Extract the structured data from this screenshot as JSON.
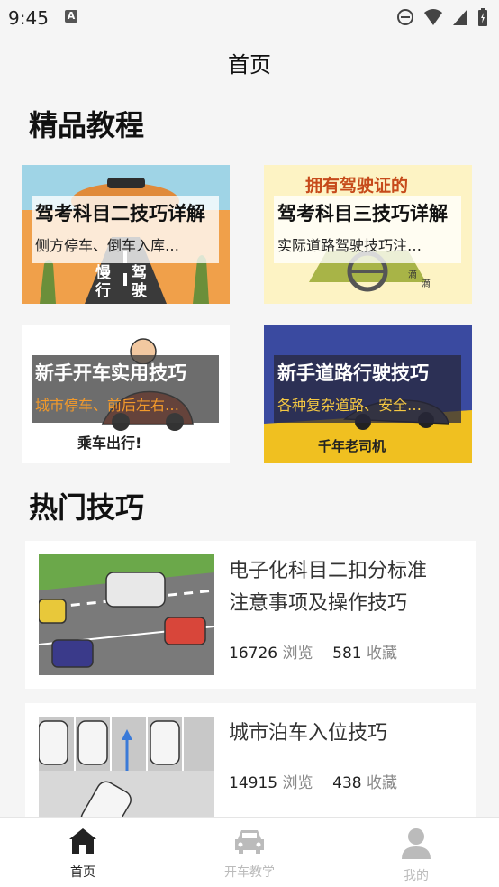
{
  "status_bar": {
    "time": "9:45"
  },
  "header": {
    "title": "首页"
  },
  "section_featured": {
    "title": "精品教程"
  },
  "featured": [
    {
      "title": "驾考科目二技巧详解",
      "subtitle": "侧方停车、倒车入库…",
      "banner": "慢 驾 行 驶"
    },
    {
      "title": "驾考科目三技巧详解",
      "subtitle": "实际道路驾驶技巧注…",
      "banner": "拥有驾驶证的"
    },
    {
      "title": "新手开车实用技巧",
      "subtitle": "城市停车、前后左右…",
      "banner": "乘车出行!"
    },
    {
      "title": "新手道路行驶技巧",
      "subtitle": "各种复杂道路、安全…",
      "banner": "千年老司机"
    }
  ],
  "section_hot": {
    "title": "热门技巧"
  },
  "hot": [
    {
      "title_line1": "电子化科目二扣分标准",
      "title_line2": "注意事项及操作技巧",
      "views": "16726",
      "views_label": "浏览",
      "favs": "581",
      "favs_label": "收藏"
    },
    {
      "title_line1": "城市泊车入位技巧",
      "views": "14915",
      "views_label": "浏览",
      "favs": "438",
      "favs_label": "收藏"
    }
  ],
  "tabs": [
    {
      "label": "首页",
      "active": true
    },
    {
      "label": "开车教学",
      "active": false
    },
    {
      "label": "我的",
      "active": false
    }
  ],
  "colors": {
    "active_tab": "#222222",
    "inactive_tab": "#bbbbbb",
    "orange": "#f39a2b"
  }
}
